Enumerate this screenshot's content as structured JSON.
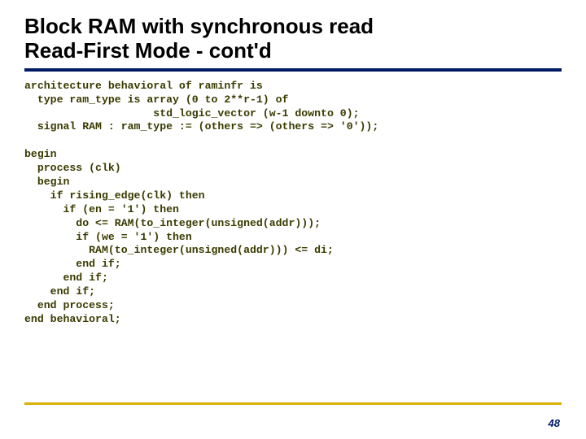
{
  "title_line1": "Block RAM with synchronous read",
  "title_line2": "Read-First Mode - cont'd",
  "code": "architecture behavioral of raminfr is\n  type ram_type is array (0 to 2**r-1) of\n                    std_logic_vector (w-1 downto 0);\n  signal RAM : ram_type := (others => (others => '0'));\n\nbegin\n  process (clk)\n  begin\n    if rising_edge(clk) then\n      if (en = '1') then\n        do <= RAM(to_integer(unsigned(addr)));\n        if (we = '1') then\n          RAM(to_integer(unsigned(addr))) <= di;\n        end if;\n      end if;\n    end if;\n  end process;\nend behavioral;",
  "page_number": "48"
}
